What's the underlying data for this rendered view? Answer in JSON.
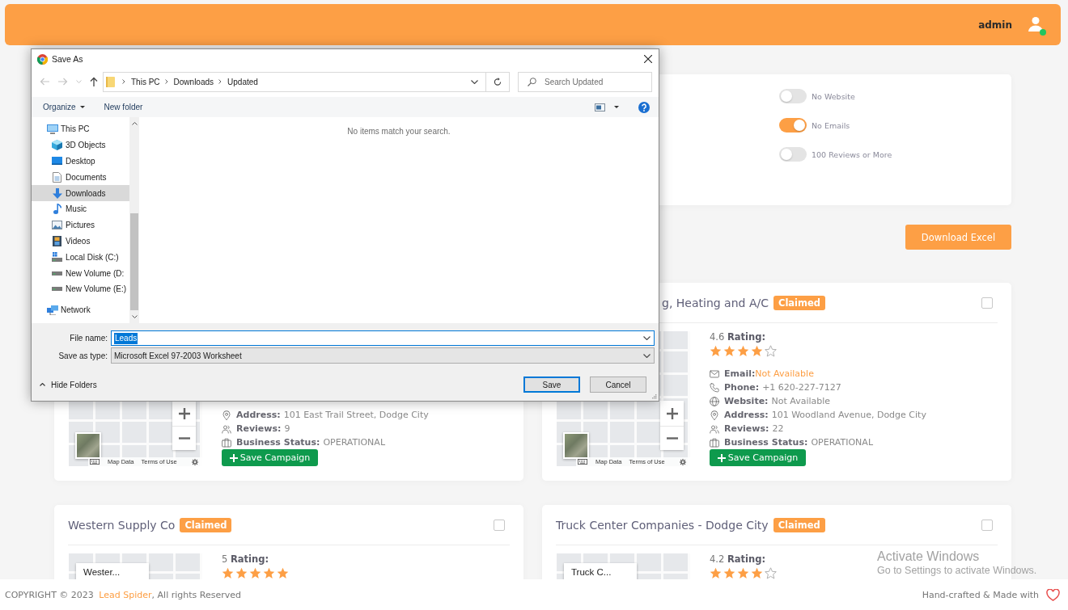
{
  "header": {
    "user_name": "admin",
    "online": true
  },
  "filters": [
    {
      "label": "No Website",
      "on": false
    },
    {
      "label": "No Emails",
      "on": true
    },
    {
      "label": "100 Reviews or More",
      "on": false
    }
  ],
  "download_button": "Download Excel",
  "listings": [
    {
      "map": {
        "footer_links": [
          "Map Data",
          "Terms of Use"
        ]
      },
      "details": [
        {
          "kind": "address",
          "label": "Address:",
          "value": "101 East Trail Street, Dodge City",
          "highlighted": false
        },
        {
          "kind": "reviews",
          "label": "Reviews:",
          "value": "9",
          "highlighted": false
        },
        {
          "kind": "status",
          "label": "Business Status:",
          "value": "OPERATIONAL",
          "highlighted": false
        }
      ],
      "save_button": "Save Campaign"
    },
    {
      "name": "g, Heating and A/C",
      "badge": "Claimed",
      "checked": false,
      "map": {
        "footer_links": [
          "Map Data",
          "Terms of Use"
        ]
      },
      "rating": "4.6 **Rating:**",
      "stars": 4,
      "details": [
        {
          "kind": "email",
          "label": "Email:",
          "value": "Not Available",
          "highlighted": true
        },
        {
          "kind": "phone",
          "label": "Phone:",
          "value": "+1 620-227-7127",
          "highlighted": false
        },
        {
          "kind": "website",
          "label": "Website:",
          "value": "Not Available",
          "highlighted": false
        },
        {
          "kind": "address",
          "label": "Address:",
          "value": "101 Woodland Avenue, Dodge City",
          "highlighted": false
        },
        {
          "kind": "reviews",
          "label": "Reviews:",
          "value": "22",
          "highlighted": false
        },
        {
          "kind": "status",
          "label": "Business Status:",
          "value": "OPERATIONAL",
          "highlighted": false
        }
      ],
      "save_button": "Save Campaign"
    },
    {
      "name": "Western Supply Co",
      "badge": "Claimed",
      "checked": false,
      "map": {
        "place_label": "Wester..."
      },
      "rating": "5 **Rating:**",
      "stars": 5
    },
    {
      "name": "Truck Center Companies - Dodge City",
      "badge": "Claimed",
      "checked": false,
      "map": {
        "place_label": "Truck C..."
      },
      "rating": "4.2 **Rating:**",
      "stars": 4
    }
  ],
  "save_dialog": {
    "title": "Save As",
    "breadcrumb": [
      "This PC",
      "Downloads",
      "Updated"
    ],
    "search": {
      "placeholder": "Search Updated"
    },
    "organize_menu": "Organize",
    "new_folder_button": "New folder",
    "nav_tree": [
      {
        "label": "This PC",
        "kind": "pc",
        "selected": false,
        "children": [
          {
            "label": "3D Objects",
            "kind": "objects3d",
            "selected": false
          },
          {
            "label": "Desktop",
            "kind": "desktop",
            "selected": false
          },
          {
            "label": "Documents",
            "kind": "documents",
            "selected": false
          },
          {
            "label": "Downloads",
            "kind": "downloads",
            "selected": true
          },
          {
            "label": "Music",
            "kind": "music",
            "selected": false
          },
          {
            "label": "Pictures",
            "kind": "pictures",
            "selected": false
          },
          {
            "label": "Videos",
            "kind": "videos",
            "selected": false
          },
          {
            "label": "Local Disk (C:)",
            "kind": "system_drive",
            "selected": false
          },
          {
            "label": "New Volume (D:",
            "kind": "drive",
            "selected": false
          },
          {
            "label": "New Volume (E:)",
            "kind": "drive",
            "selected": false
          }
        ]
      },
      {
        "label": "Network",
        "kind": "network",
        "selected": false
      }
    ],
    "empty_message": "No items match your search.",
    "file_name": {
      "label": "File name:",
      "value": "Leads",
      "text_selected": true
    },
    "save_as_type": {
      "label": "Save as type:",
      "value": "Microsoft Excel 97-2003 Worksheet"
    },
    "hide_folders": "Hide Folders",
    "buttons": [
      {
        "label": "Save",
        "default": true
      },
      {
        "label": "Cancel",
        "default": false
      }
    ]
  },
  "footer": {
    "copyright": "COPYRIGHT © 2023",
    "brand_link": "Lead Spider",
    "rights": ", All rights Reserved",
    "credit": "Hand-crafted & Made with"
  },
  "windows_notice": {
    "title": "Activate Windows",
    "message": "Go to Settings to activate Windows."
  }
}
